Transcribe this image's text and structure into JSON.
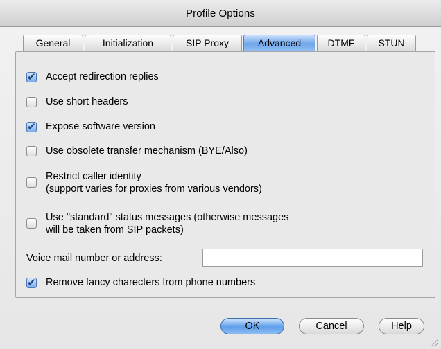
{
  "window": {
    "title": "Profile Options"
  },
  "tabs": [
    {
      "label": "General",
      "active": false
    },
    {
      "label": "Initialization",
      "active": false
    },
    {
      "label": "SIP Proxy",
      "active": false
    },
    {
      "label": "Advanced",
      "active": true
    },
    {
      "label": "DTMF",
      "active": false
    },
    {
      "label": "STUN",
      "active": false
    }
  ],
  "options": [
    {
      "label": "Accept redirection replies",
      "checked": true
    },
    {
      "label": "Use short headers",
      "checked": false
    },
    {
      "label": "Expose software version",
      "checked": true
    },
    {
      "label": "Use obsolete transfer mechanism (BYE/Also)",
      "checked": false
    },
    {
      "label_line1": "Restrict caller identity",
      "label_line2": "(support varies for proxies from various vendors)",
      "checked": false
    },
    {
      "label_line1": "Use \"standard\" status messages (otherwise messages",
      "label_line2": "will be taken from SIP packets)",
      "checked": false
    },
    {
      "label": "Remove fancy charecters from phone numbers",
      "checked": true
    }
  ],
  "voicemail": {
    "label": "Voice mail number or address:",
    "value": ""
  },
  "buttons": {
    "ok": "OK",
    "cancel": "Cancel",
    "help": "Help"
  },
  "colors": {
    "accent": "#6fa6ea",
    "panel": "#e9e9e9",
    "window": "#ececec"
  }
}
